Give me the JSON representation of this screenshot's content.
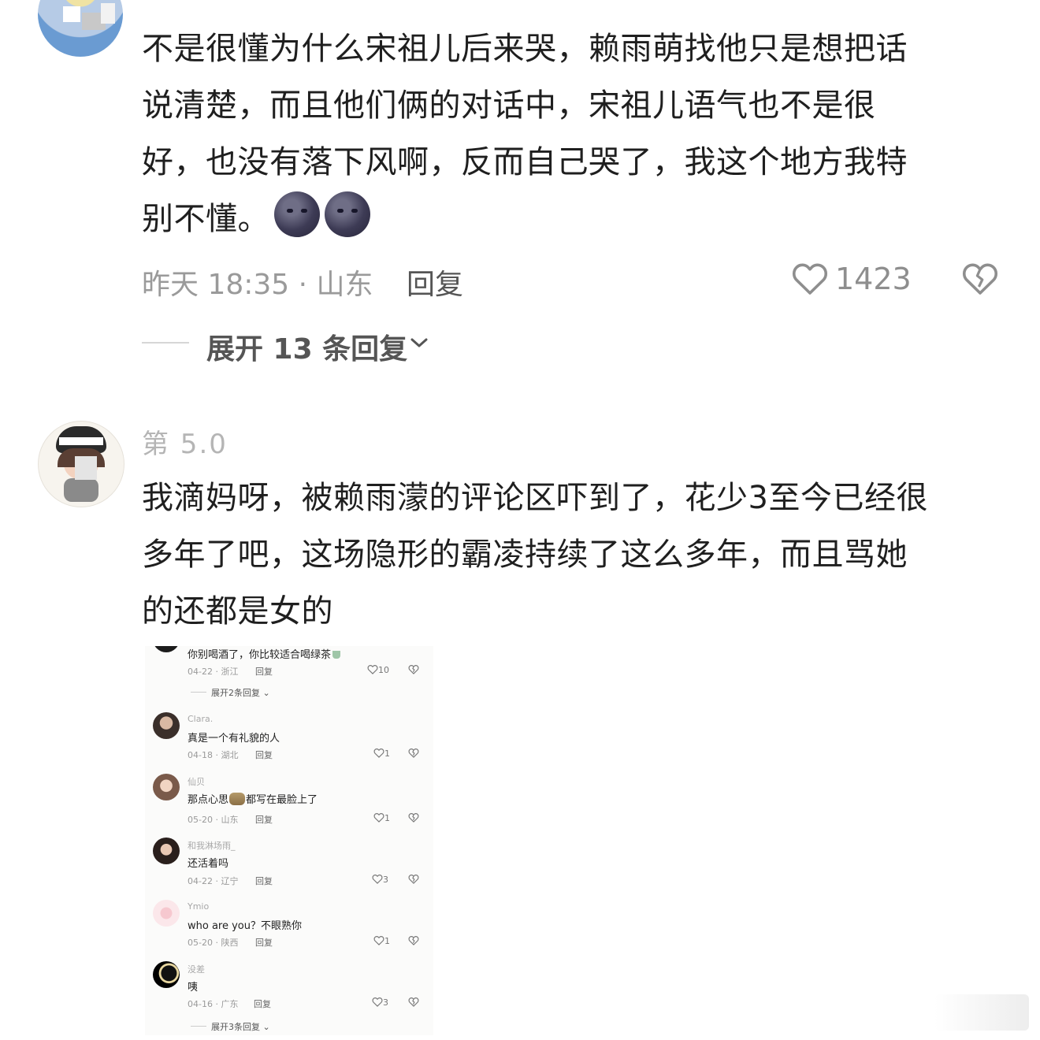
{
  "comment1": {
    "text_lines": [
      "不是很懂为什么宋祖儿后来哭，赖雨萌找他只是想把话",
      "说清楚，而且他们俩的对话中，宋祖儿语气也不是很",
      "好，也没有落下风啊，反而自己哭了，我这个地方我特",
      "别不懂。"
    ],
    "emoji": [
      "new-moon-face",
      "new-moon-face"
    ],
    "time_location": "昨天 18:35 · 山东",
    "reply_label": "回复",
    "like_count": "1423",
    "expand_label": "展开 13 条回复"
  },
  "comment2": {
    "username": "第 5.0",
    "text_lines": [
      "我滴妈呀，被赖雨濛的评论区吓到了，花少3至今已经很",
      "多年了吧，这场隐形的霸凌持续了这么多年，而且骂她",
      "的还都是女的"
    ]
  },
  "embedded": {
    "top_comment": {
      "text": "你别喝酒了，你比较适合喝绿茶",
      "date": "04-22",
      "location": "浙江",
      "reply_label": "回复",
      "likes": "10",
      "expand": "展开2条回复"
    },
    "comments": [
      {
        "username": "Clara.",
        "text": "真是一个有礼貌的人",
        "date": "04-18",
        "location": "湖北",
        "reply_label": "回复",
        "likes": "1"
      },
      {
        "username": "仙贝",
        "text_before": "那点心思",
        "text_after": "都写在最脸上了",
        "date": "05-20",
        "location": "山东",
        "reply_label": "回复",
        "likes": "1"
      },
      {
        "username": "和我淋场雨_",
        "text": "还活着吗",
        "date": "04-22",
        "location": "辽宁",
        "reply_label": "回复",
        "likes": "3"
      },
      {
        "username": "Ymio",
        "text": "who are you？不眼熟你",
        "date": "05-20",
        "location": "陕西",
        "reply_label": "回复",
        "likes": "1"
      },
      {
        "username": "没差",
        "text": "咦",
        "date": "04-16",
        "location": "广东",
        "reply_label": "回复",
        "likes": "3"
      }
    ],
    "bottom_expand": "展开3条回复"
  },
  "colors": {
    "body_text": "#1f1f1f",
    "meta_gray": "#9a9a9a",
    "icon_gray": "#8e8e8e"
  }
}
